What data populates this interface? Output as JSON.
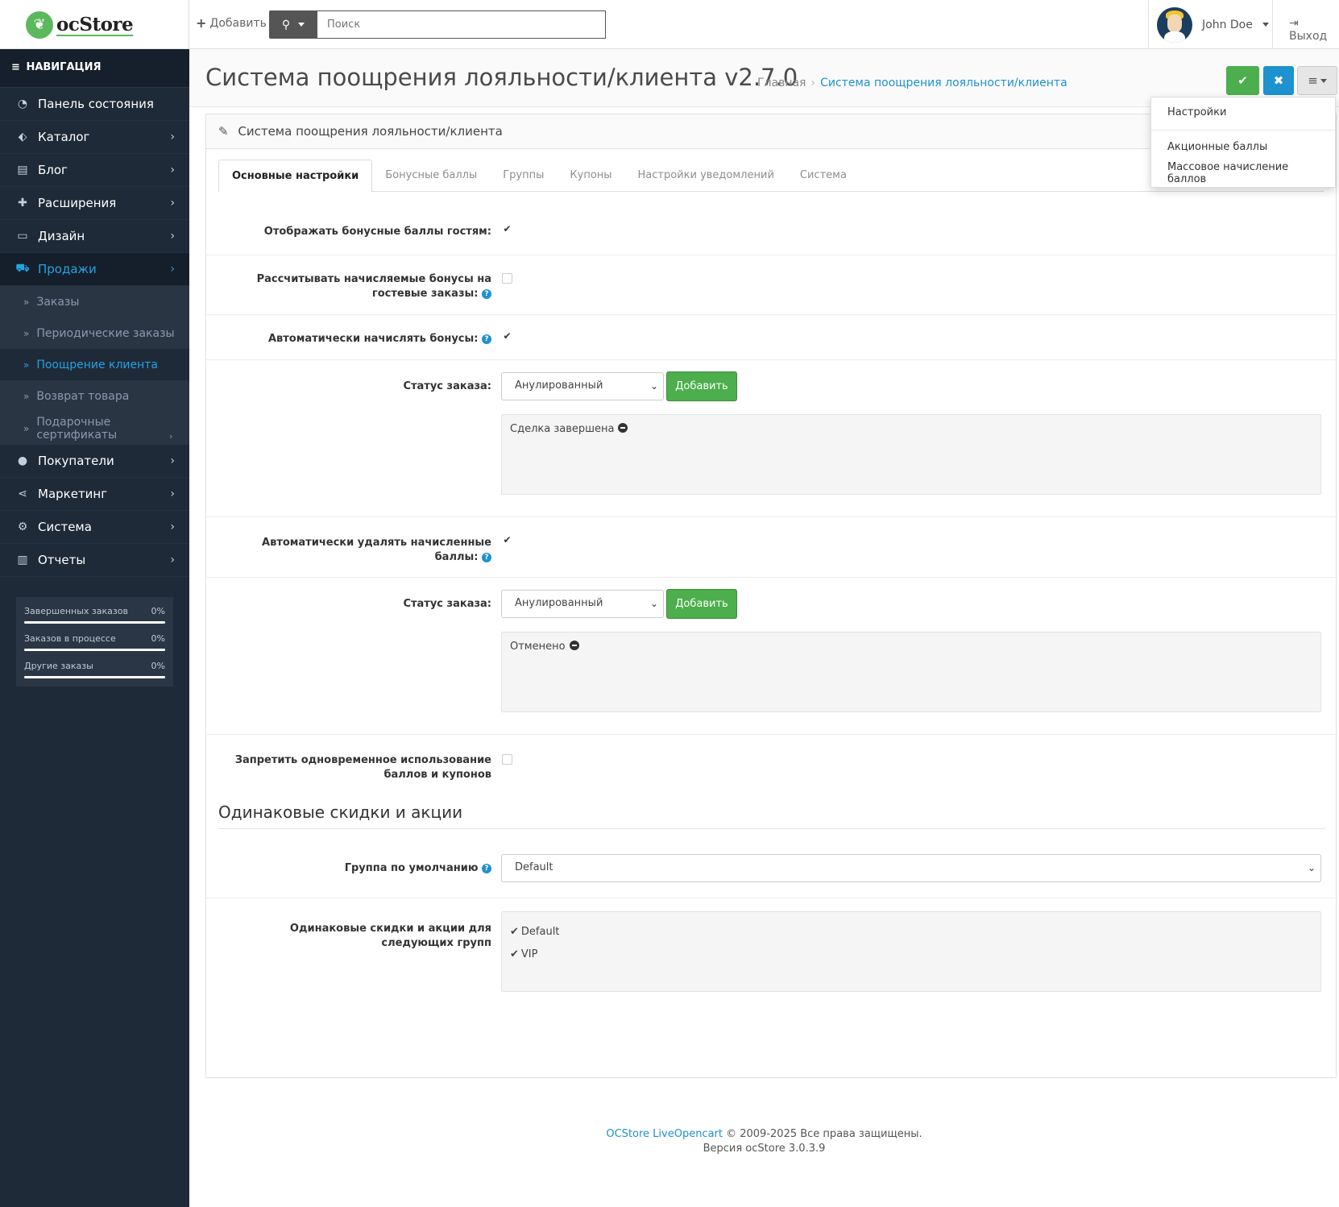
{
  "header": {
    "logo_text": "ocStore",
    "add_label": "Добавить",
    "search_placeholder": "Поиск",
    "user_name": "John Doe",
    "logout_label": "Выход"
  },
  "sidebar": {
    "nav_heading": "НАВИГАЦИЯ",
    "items": [
      {
        "label": "Панель состояния",
        "icon": "dashboard-icon"
      },
      {
        "label": "Каталог",
        "icon": "tags-icon"
      },
      {
        "label": "Блог",
        "icon": "book-icon"
      },
      {
        "label": "Расширения",
        "icon": "puzzle-icon"
      },
      {
        "label": "Дизайн",
        "icon": "monitor-icon"
      },
      {
        "label": "Продажи",
        "icon": "cart-icon"
      }
    ],
    "sales_sub": [
      {
        "label": "Заказы"
      },
      {
        "label": "Периодические заказы"
      },
      {
        "label": "Поощрение клиента"
      },
      {
        "label": "Возврат товара"
      },
      {
        "label": "Подарочные сертификаты"
      }
    ],
    "items_after": [
      {
        "label": "Покупатели",
        "icon": "user-icon"
      },
      {
        "label": "Маркетинг",
        "icon": "share-icon"
      },
      {
        "label": "Система",
        "icon": "gear-icon"
      },
      {
        "label": "Отчеты",
        "icon": "bar-chart-icon"
      }
    ],
    "stats": [
      {
        "label": "Завершенных заказов",
        "value": "0%"
      },
      {
        "label": "Заказов в процессе",
        "value": "0%"
      },
      {
        "label": "Другие заказы",
        "value": "0%"
      }
    ]
  },
  "page": {
    "title": "Система поощрения лояльности/клиента v2.7.0",
    "breadcrumb_home": "Главная",
    "breadcrumb_current": "Система поощрения лояльности/клиента",
    "dropdown": {
      "item1": "Настройки",
      "item2": "Акционные баллы",
      "item3": "Массовое начисление баллов"
    }
  },
  "panel": {
    "heading": "Система поощрения лояльности/клиента",
    "tabs": [
      "Основные настройки",
      "Бонусные баллы",
      "Группы",
      "Купоны",
      "Настройки уведомлений",
      "Система"
    ]
  },
  "form": {
    "show_guests_label": "Отображать бонусные баллы гостям:",
    "show_guests_checked": true,
    "calc_guest_label": "Рассчитывать начисляемые бонусы на гостевые заказы:",
    "calc_guest_checked": false,
    "auto_add_label": "Автоматически начислять бонусы:",
    "auto_add_checked": true,
    "status1_label": "Статус заказа:",
    "status1_value": "Анулированный",
    "add_button": "Добавить",
    "status1_list": [
      "Сделка завершена"
    ],
    "auto_remove_label": "Автоматически удалять начисленные баллы:",
    "auto_remove_checked": true,
    "status2_label": "Статус заказа:",
    "status2_value": "Анулированный",
    "status2_list": [
      "Отменено"
    ],
    "forbid_label": "Запретить одновременное использование баллов и купонов",
    "forbid_checked": false,
    "legend": "Одинаковые скидки и акции",
    "default_group_label": "Группа по умолчанию",
    "default_group_value": "Default",
    "same_groups_label": "Одинаковые скидки и акции для следующих групп",
    "groups": [
      {
        "name": "Default",
        "checked": true
      },
      {
        "name": "VIP",
        "checked": true
      }
    ]
  },
  "footer": {
    "link": "OCStore LiveOpencart",
    "copyright": " © 2009-2025 Все права защищены.",
    "version": "Версия ocStore 3.0.3.9"
  },
  "colors": {
    "sidebar_bg": "#1e2a38",
    "accent_blue": "#1e91cf",
    "success_green": "#4cae4c"
  }
}
